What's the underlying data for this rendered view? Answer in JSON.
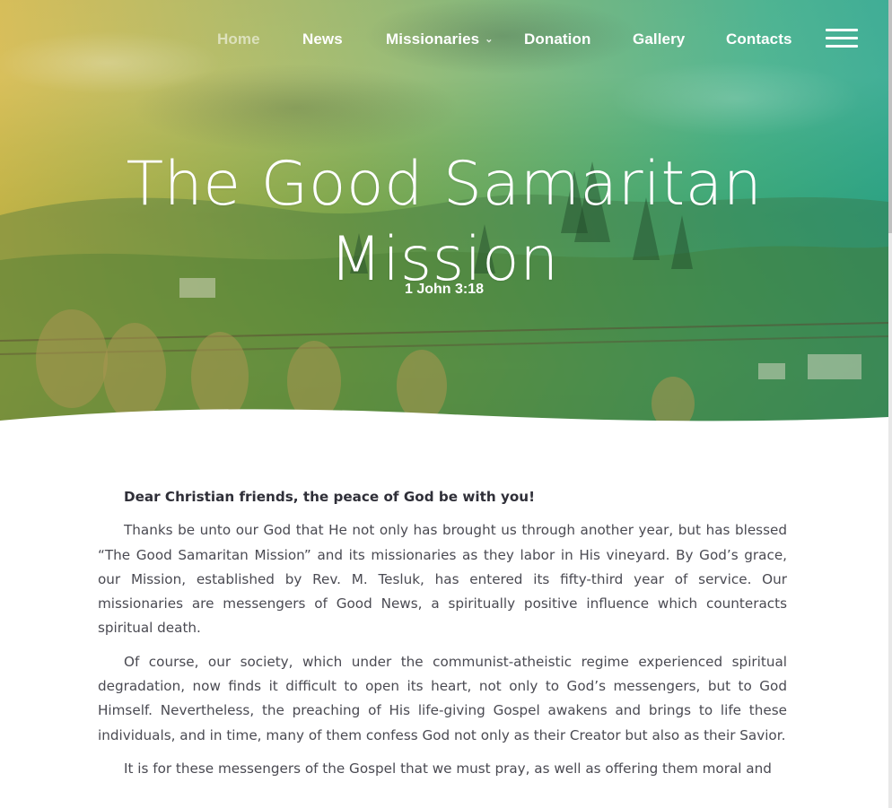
{
  "nav": {
    "items": [
      {
        "label": "Home",
        "active": true
      },
      {
        "label": "News"
      },
      {
        "label": "Missionaries",
        "has_submenu": true
      },
      {
        "label": "Donation"
      },
      {
        "label": "Gallery"
      },
      {
        "label": "Contacts"
      }
    ],
    "submenu_icon": "chevron-down-icon",
    "menu_icon": "hamburger-menu-icon"
  },
  "hero": {
    "title_line1": "The Good Samaritan",
    "title_line2": "Mission",
    "subtitle": "1 John 3:18"
  },
  "content": {
    "paragraphs": [
      "Dear Christian friends, the peace of God be with you!",
      "Thanks be unto our God that He not only has brought us through another year, but has blessed “The Good Samaritan Mission” and its missionaries as they labor in His vineyard. By God’s grace, our Mission, established by Rev. M. Tesluk, has entered its fifty-third year of service. Our missionaries are messengers of Good News, a spiritually positive influence which counteracts spiritual death.",
      "Of course, our society, which under the communist-atheistic regime experienced spiritual degradation, now finds it difficult to open its heart, not only to God’s messengers, but to God Himself. Nevertheless, the preaching of His life-giving Gospel awakens and brings to life these individuals, and in time, many of them confess God not only as their Creator but also as their Savior.",
      "It is for these messengers of the Gospel that we must pray, as well as offering them moral and"
    ]
  },
  "colors": {
    "gradient_left": "#ebc446",
    "gradient_right": "#1eaa96",
    "text": "#4a4a52",
    "white": "#ffffff"
  }
}
